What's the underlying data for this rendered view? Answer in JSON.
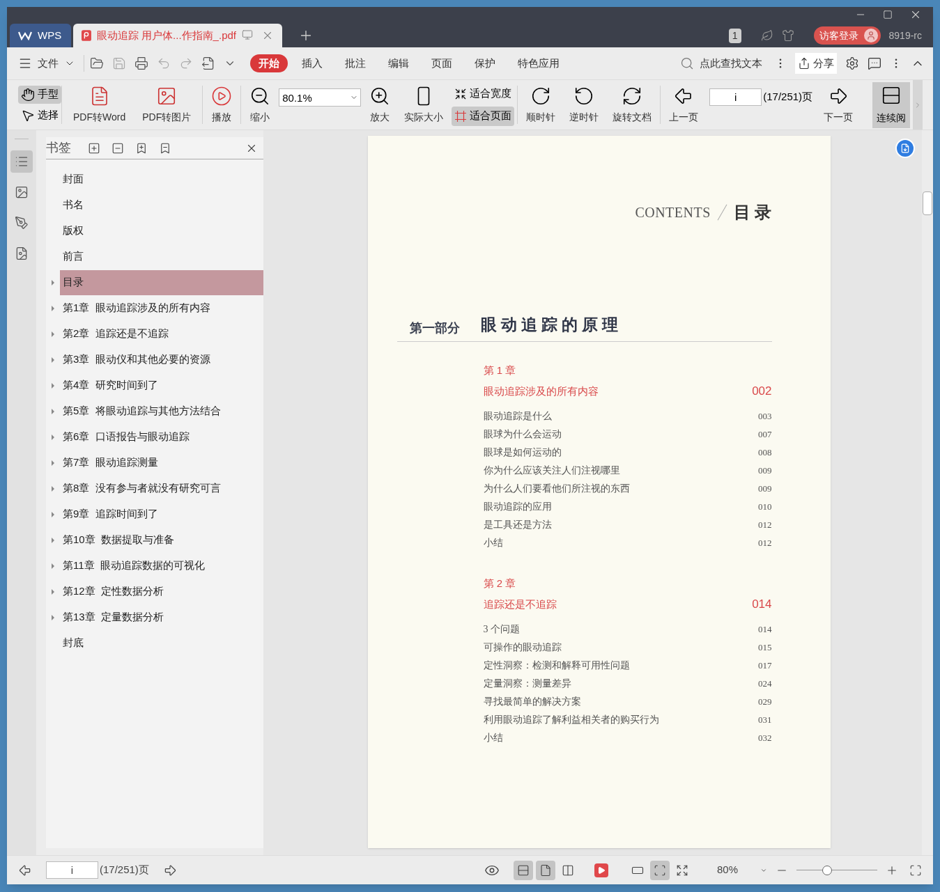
{
  "title_bar": {
    "tabs": [
      {
        "label": "WPS",
        "kind": "home",
        "selected": false
      },
      {
        "label": "眼动追踪 用户体...作指南_.pdf",
        "kind": "document",
        "selected": true
      }
    ],
    "badge": "1",
    "login_button": "访客登录",
    "version": "8919-rc"
  },
  "menu_bar": {
    "file_menu": "文件",
    "tabs": [
      {
        "label": "开始",
        "selected": true
      },
      {
        "label": "插入",
        "selected": false
      },
      {
        "label": "批注",
        "selected": false
      },
      {
        "label": "编辑",
        "selected": false
      },
      {
        "label": "页面",
        "selected": false
      },
      {
        "label": "保护",
        "selected": false
      },
      {
        "label": "特色应用",
        "selected": false
      }
    ],
    "search": {
      "placeholder": "点此查找文本"
    },
    "share_button": "分享"
  },
  "ribbon": {
    "tools": [
      {
        "label": "手型",
        "kind": "hand",
        "selected": true
      },
      {
        "label": "选择",
        "kind": "select",
        "selected": false
      }
    ],
    "convert": [
      {
        "label": "PDF转Word",
        "kind": "pdf-to-word"
      },
      {
        "label": "PDF转图片",
        "kind": "pdf-to-image"
      }
    ],
    "play": "播放",
    "zoom_out": "缩小",
    "zoom_field": {
      "value": "80.1%"
    },
    "zoom_in": "放大",
    "actual_size": "实际大小",
    "fit_options": [
      {
        "label": "适合宽度",
        "kind": "width",
        "selected": false
      },
      {
        "label": "适合页面",
        "kind": "page",
        "selected": true
      }
    ],
    "rotate": [
      {
        "label": "顺时针",
        "kind": "cw"
      },
      {
        "label": "逆时针",
        "kind": "ccw"
      },
      {
        "label": "旋转文档",
        "kind": "doc"
      }
    ],
    "prev_page": "上一页",
    "page_field": {
      "value": "i"
    },
    "page_count": "(17/251)页",
    "next_page": "下一页",
    "continuous": {
      "label": "连续阅",
      "selected": true
    }
  },
  "left_rail": [
    {
      "kind": "bookmarks",
      "selected": true
    },
    {
      "kind": "thumbnails",
      "selected": false
    },
    {
      "kind": "sign",
      "selected": false
    },
    {
      "kind": "convert",
      "selected": false
    }
  ],
  "bookmarks": {
    "title": "书签",
    "items": [
      {
        "label": "封面",
        "expandable": false,
        "selected": false
      },
      {
        "label": "书名",
        "expandable": false,
        "selected": false
      },
      {
        "label": "版权",
        "expandable": false,
        "selected": false
      },
      {
        "label": "前言",
        "expandable": false,
        "selected": false
      },
      {
        "label": "目录",
        "expandable": true,
        "selected": true
      },
      {
        "label": "第1章  眼动追踪涉及的所有内容",
        "expandable": true,
        "selected": false
      },
      {
        "label": "第2章  追踪还是不追踪",
        "expandable": true,
        "selected": false
      },
      {
        "label": "第3章  眼动仪和其他必要的资源",
        "expandable": true,
        "selected": false
      },
      {
        "label": "第4章  研究时间到了",
        "expandable": true,
        "selected": false
      },
      {
        "label": "第5章  将眼动追踪与其他方法结合",
        "expandable": true,
        "selected": false
      },
      {
        "label": "第6章  口语报告与眼动追踪",
        "expandable": true,
        "selected": false
      },
      {
        "label": "第7章  眼动追踪测量",
        "expandable": true,
        "selected": false
      },
      {
        "label": "第8章  没有参与者就没有研究可言",
        "expandable": true,
        "selected": false
      },
      {
        "label": "第9章  追踪时间到了",
        "expandable": true,
        "selected": false
      },
      {
        "label": "第10章  数据提取与准备",
        "expandable": true,
        "selected": false
      },
      {
        "label": "第11章  眼动追踪数据的可视化",
        "expandable": true,
        "selected": false
      },
      {
        "label": "第12章  定性数据分析",
        "expandable": true,
        "selected": false
      },
      {
        "label": "第13章  定量数据分析",
        "expandable": true,
        "selected": false
      },
      {
        "label": "封底",
        "expandable": false,
        "selected": false
      }
    ]
  },
  "page": {
    "contents_label": "CONTENTS",
    "contents_title": "目 录",
    "part_label": "第一部分",
    "part_title": "眼动追踪的原理",
    "chapters": [
      {
        "number": "第 1 章",
        "title": "眼动追踪涉及的所有内容",
        "page": "002",
        "entries": [
          {
            "title": "眼动追踪是什么",
            "page": "003"
          },
          {
            "title": "眼球为什么会运动",
            "page": "007"
          },
          {
            "title": "眼球是如何运动的",
            "page": "008"
          },
          {
            "title": "你为什么应该关注人们注视哪里",
            "page": "009"
          },
          {
            "title": "为什么人们要看他们所注视的东西",
            "page": "009"
          },
          {
            "title": "眼动追踪的应用",
            "page": "010"
          },
          {
            "title": "是工具还是方法",
            "page": "012"
          },
          {
            "title": "小结",
            "page": "012"
          }
        ]
      },
      {
        "number": "第 2 章",
        "title": "追踪还是不追踪",
        "page": "014",
        "entries": [
          {
            "title": "3 个问题",
            "page": "014"
          },
          {
            "title": "可操作的眼动追踪",
            "page": "015"
          },
          {
            "title": "定性洞察：检测和解释可用性问题",
            "page": "017"
          },
          {
            "title": "定量洞察：测量差异",
            "page": "024"
          },
          {
            "title": "寻找最简单的解决方案",
            "page": "029"
          },
          {
            "title": "利用眼动追踪了解利益相关者的购买行为",
            "page": "031"
          },
          {
            "title": "小结",
            "page": "032"
          }
        ]
      }
    ]
  },
  "status_bar": {
    "page_field": {
      "value": "i"
    },
    "page_count": "(17/251)页",
    "view_modes": [
      {
        "kind": "continuous",
        "selected": true
      },
      {
        "kind": "single",
        "selected": true
      },
      {
        "kind": "double",
        "selected": false
      }
    ],
    "fit_modes": [
      {
        "kind": "actual",
        "selected": false
      },
      {
        "kind": "page",
        "selected": true
      },
      {
        "kind": "width",
        "selected": false
      }
    ],
    "zoom": "80%",
    "zoom_slider": {
      "level": 0.38
    }
  }
}
